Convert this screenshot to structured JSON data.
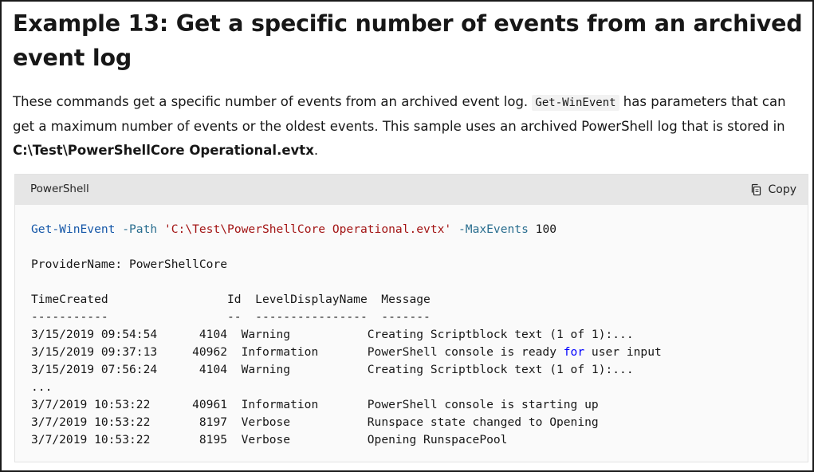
{
  "heading": {
    "title": "Example 13: Get a specific number of events from an archived event log"
  },
  "description": {
    "part1": "These commands get a specific number of events from an archived event log. ",
    "inline_code": "Get-WinEvent",
    "part2": " has parameters that can get a maximum number of events or the oldest events. This sample uses an archived PowerShell log that is stored in ",
    "path_bold": "C:\\Test\\PowerShellCore Operational.evtx",
    "part3": "."
  },
  "code_block": {
    "language": "PowerShell",
    "copy_label": "Copy",
    "command": {
      "cmdlet": "Get-WinEvent",
      "param_path": "-Path",
      "path_value": "'C:\\Test\\PowerShellCore Operational.evtx'",
      "param_max": "-MaxEvents",
      "max_value": "100"
    },
    "provider_line": "ProviderName: PowerShellCore",
    "table_header": "TimeCreated                 Id  LevelDisplayName  Message",
    "table_separator": "-----------                 --  ----------------  -------",
    "rows": [
      {
        "time": "3/15/2019 09:54:54",
        "id": "4104",
        "level": "Warning",
        "message": "Creating Scriptblock text (1 of 1):..."
      },
      {
        "time": "3/15/2019 09:37:13",
        "id": "40962",
        "level": "Information",
        "message_before": "PowerShell console is ready ",
        "message_kw": "for",
        "message_after": " user input"
      },
      {
        "time": "3/15/2019 07:56:24",
        "id": "4104",
        "level": "Warning",
        "message": "Creating Scriptblock text (1 of 1):..."
      },
      {
        "ellipsis": "..."
      },
      {
        "time": "3/7/2019 10:53:22",
        "id": "40961",
        "level": "Information",
        "message": "PowerShell console is starting up"
      },
      {
        "time": "3/7/2019 10:53:22",
        "id": "8197",
        "level": "Verbose",
        "message": "Runspace state changed to Opening"
      },
      {
        "time": "3/7/2019 10:53:22",
        "id": "8195",
        "level": "Verbose",
        "message": "Opening RunspacePool"
      }
    ]
  }
}
